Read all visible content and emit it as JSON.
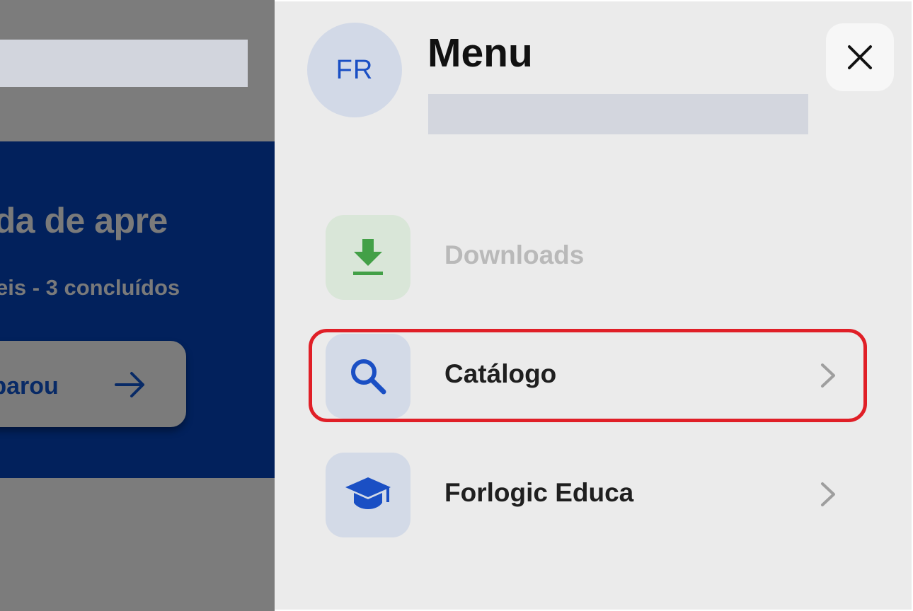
{
  "background": {
    "title": "jornada de apre",
    "subtitle": "eis - 3 concluídos",
    "button_label": "e parou"
  },
  "drawer": {
    "avatar_initials": "FR",
    "title": "Menu",
    "items": [
      {
        "label": "Downloads",
        "icon": "download-icon",
        "disabled": true
      },
      {
        "label": "Catálogo",
        "icon": "search-icon"
      },
      {
        "label": "Forlogic Educa",
        "icon": "graduation-cap-icon"
      }
    ]
  },
  "colors": {
    "overlay": "#7b7b7b",
    "drawer_bg": "#ebebeb",
    "accent_blue": "#1a4fc4",
    "download_green": "#43a047",
    "highlight_red": "#e01f27",
    "banner_navy": "#02215c"
  }
}
